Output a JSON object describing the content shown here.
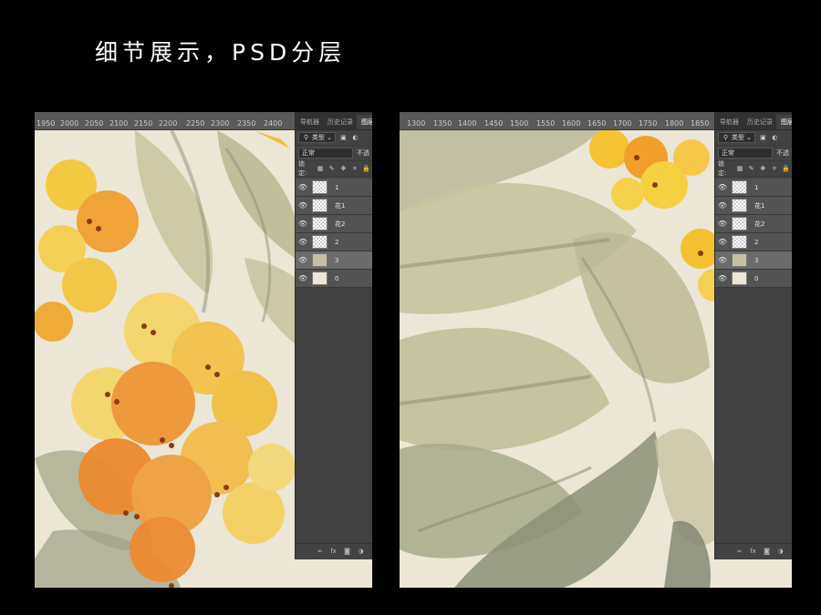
{
  "title": "细节展示，PSD分层",
  "left": {
    "ruler": [
      "1950",
      "2000",
      "2050",
      "2100",
      "2150",
      "2200",
      "2250",
      "2300",
      "2350",
      "2400"
    ]
  },
  "right": {
    "ruler": [
      "1300",
      "1350",
      "1400",
      "1450",
      "1500",
      "1550",
      "1600",
      "1650",
      "1700",
      "1750",
      "1800",
      "1850"
    ]
  },
  "panel": {
    "tabs": [
      "导航器",
      "历史记录",
      "图层"
    ],
    "filter_label": "类型",
    "blend_mode": "正常",
    "opacity_label": "不透",
    "lock_label": "锁定:",
    "layers": [
      {
        "name": "1",
        "thumb": "transparent"
      },
      {
        "name": "花1",
        "thumb": "transparent"
      },
      {
        "name": "花2",
        "thumb": "transparent"
      },
      {
        "name": "2",
        "thumb": "transparent"
      },
      {
        "name": "3",
        "thumb": "image"
      },
      {
        "name": "0",
        "thumb": "solid"
      }
    ],
    "footer_icons": [
      "link-icon",
      "fx-icon",
      "mask-icon",
      "adjustment-icon"
    ],
    "fx_text": "fx"
  },
  "colors": {
    "background": "#000000",
    "panel": "#424242",
    "canvas": "#ece6d7",
    "flower_orange": "#f0a030",
    "flower_yellow": "#f5d050",
    "leaf": "#b9b48c"
  }
}
